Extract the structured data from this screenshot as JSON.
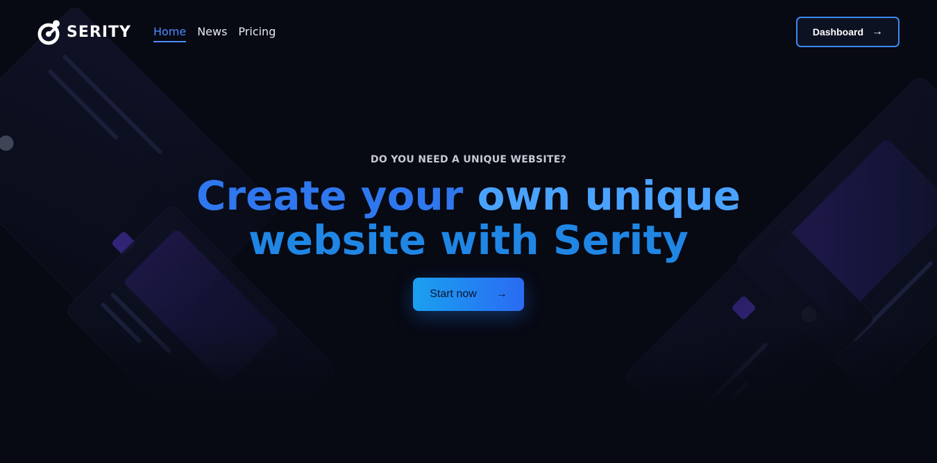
{
  "brand": {
    "name": "SERITY"
  },
  "nav": {
    "items": [
      {
        "label": "Home",
        "active": true
      },
      {
        "label": "News",
        "active": false
      },
      {
        "label": "Pricing",
        "active": false
      }
    ]
  },
  "header": {
    "dashboard_label": "Dashboard",
    "dashboard_icon": "arrow-right-icon"
  },
  "hero": {
    "eyebrow": "DO YOU NEED A UNIQUE WEBSITE?",
    "headline_part1": "Create your",
    "headline_part2": "own unique",
    "headline_line2": "website with Serity",
    "cta_label": "Start now",
    "cta_icon": "arrow-right-icon"
  },
  "colors": {
    "background": "#070913",
    "accent": "#4d8dff",
    "cta_gradient_start": "#1aa0f0",
    "cta_gradient_end": "#2a6bf2"
  }
}
